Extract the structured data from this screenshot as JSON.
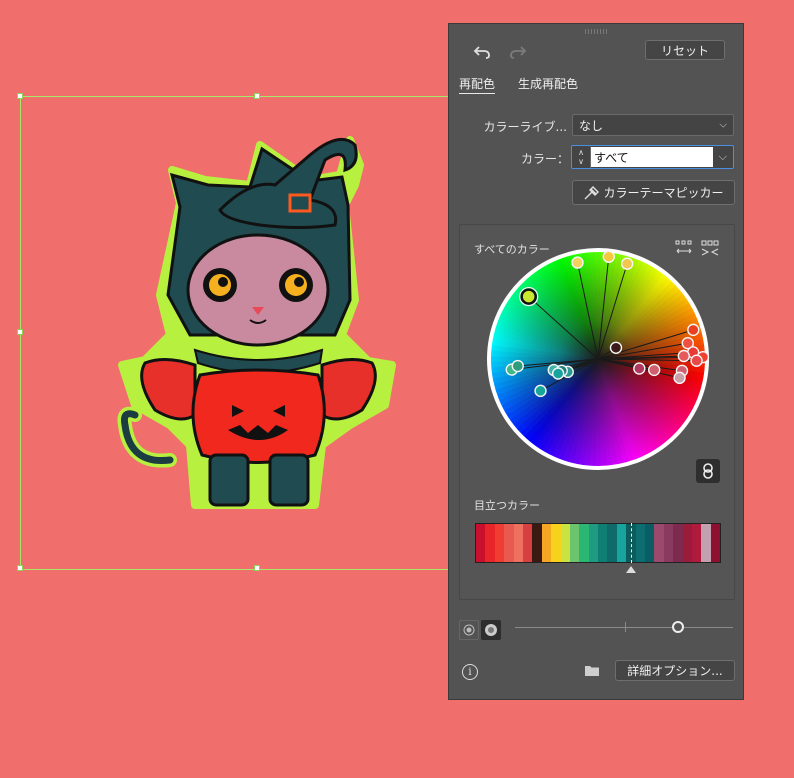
{
  "panel": {
    "reset_label": "リセット",
    "tabs": [
      {
        "label": "再配色",
        "active": true
      },
      {
        "label": "生成再配色",
        "active": false
      }
    ],
    "library": {
      "label": "カラーライブ...",
      "value": "なし"
    },
    "colors": {
      "label": "カラー：",
      "value": "すべて"
    },
    "picker_label": "カラーテーマピッカー",
    "all_colors_label": "すべてのカラー",
    "prominent_label": "目立つカラー",
    "advanced_label": "詳細オプション...",
    "strip_colors": [
      "#c8102e",
      "#e8262a",
      "#f03c32",
      "#e85a4f",
      "#f07060",
      "#d64040",
      "#3a1a12",
      "#f5a623",
      "#f7d21a",
      "#c9e342",
      "#6cc56d",
      "#2bb673",
      "#1e9b80",
      "#0f7f74",
      "#0e6b6a",
      "#17a39e",
      "#0b5c5a",
      "#0d6e72",
      "#0a5d63",
      "#9b4a6e",
      "#8a3a5e",
      "#7e2a4e",
      "#9a1c3a",
      "#b01a3c",
      "#c3a0b0",
      "#8e1030"
    ]
  },
  "wheel_markers": [
    {
      "color": "#c8e830",
      "sat": 0.88,
      "hue_deg": -48,
      "base": true
    },
    {
      "color": "#f3d35a",
      "sat": 0.93,
      "hue_deg": -12
    },
    {
      "color": "#f3c93e",
      "sat": 0.97,
      "hue_deg": 6
    },
    {
      "color": "#f0c850",
      "sat": 0.94,
      "hue_deg": 17
    },
    {
      "color": "#e84020",
      "sat": 0.94,
      "hue_deg": 73
    },
    {
      "color": "#f05040",
      "sat": 0.86,
      "hue_deg": 80
    },
    {
      "color": "#e83a36",
      "sat": 0.9,
      "hue_deg": 86
    },
    {
      "color": "#f04030",
      "sat": 0.99,
      "hue_deg": 89
    },
    {
      "color": "#e84848",
      "sat": 0.93,
      "hue_deg": 91
    },
    {
      "color": "#e85a5a",
      "sat": 0.81,
      "hue_deg": 88
    },
    {
      "color": "#d06070",
      "sat": 0.8,
      "hue_deg": 98
    },
    {
      "color": "#c9a0a8",
      "sat": 0.79,
      "hue_deg": 103
    },
    {
      "color": "#d0606e",
      "sat": 0.54,
      "hue_deg": 101
    },
    {
      "color": "#b03860",
      "sat": 0.4,
      "hue_deg": 103
    },
    {
      "color": "#3a1a1a",
      "sat": 0.2,
      "hue_deg": 58
    },
    {
      "color": "#3db98a",
      "sat": 0.82,
      "hue_deg": -97
    },
    {
      "color": "#2e9e7a",
      "sat": 0.76,
      "hue_deg": -95
    },
    {
      "color": "#18a69a",
      "sat": 0.62,
      "hue_deg": -119
    },
    {
      "color": "#3bb5a8",
      "sat": 0.43,
      "hue_deg": -104
    },
    {
      "color": "#2a9a94",
      "sat": 0.31,
      "hue_deg": -113
    },
    {
      "color": "#1c7f7a",
      "sat": 0.36,
      "hue_deg": -108
    },
    {
      "color": "#17a39e",
      "sat": 0.4,
      "hue_deg": -110
    }
  ]
}
